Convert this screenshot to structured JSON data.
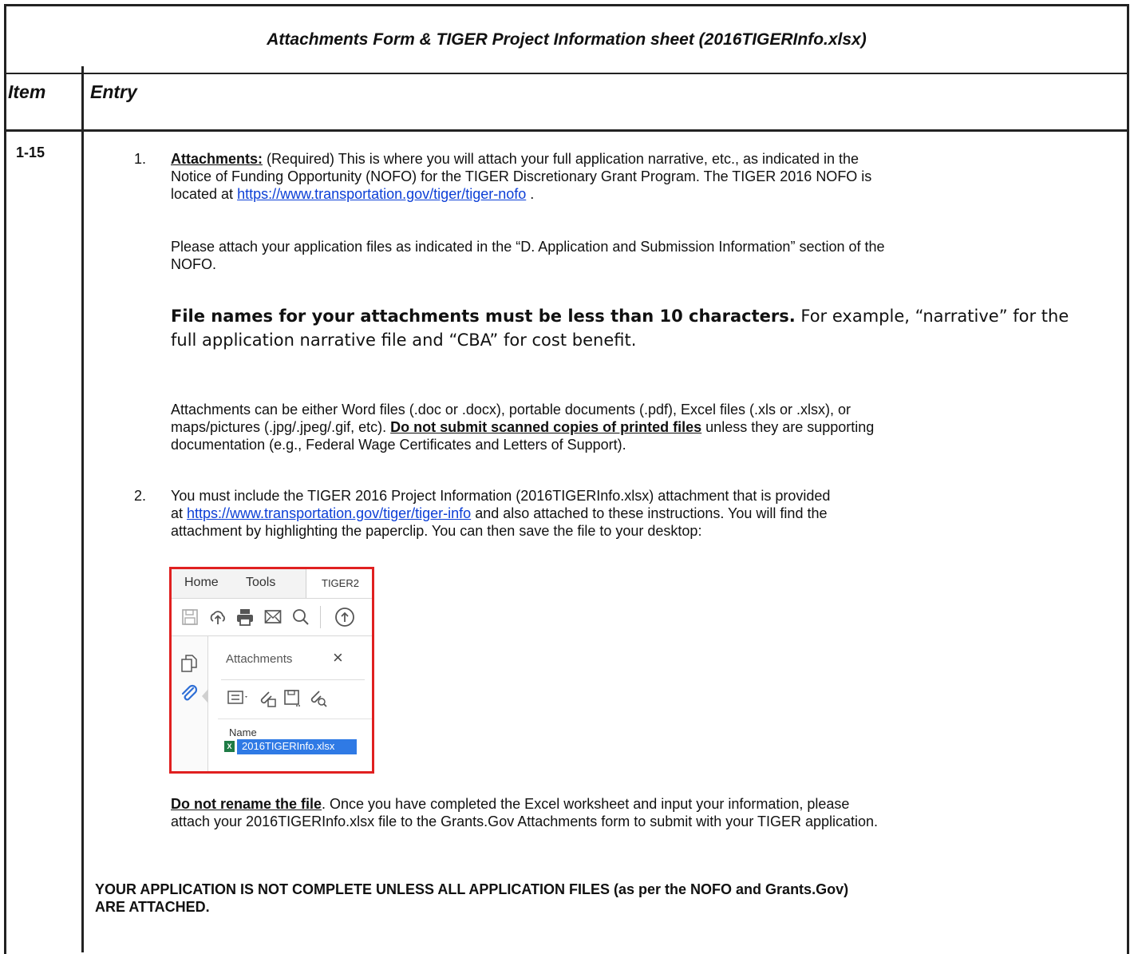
{
  "title": "Attachments Form & TIGER Project Information sheet (2016TIGERInfo.xlsx)",
  "header": {
    "item": "Item",
    "entry": "Entry"
  },
  "row": {
    "item": "1-15",
    "p1": {
      "num": "1.",
      "label": "Attachments:",
      "text_a": " (Required) This is where you will attach your full application narrative, etc., as indicated in the",
      "text_b": "Notice of Funding Opportunity (NOFO) for the TIGER Discretionary Grant Program. The TIGER 2016 NOFO is",
      "text_c": "located at ",
      "link": "https://www.transportation.gov/tiger/tiger-nofo",
      "text_d": " ."
    },
    "p2": {
      "line1": "Please attach your application files as indicated in the “D. Application and Submission Information” section of the",
      "line2": "NOFO."
    },
    "p3": {
      "bold": "File names for your attachments must be less than 10 characters.",
      "rest1": " For example, “narrative” for the",
      "rest2": "full application narrative file and “CBA” for cost benefit."
    },
    "p4": {
      "line1": "Attachments can be either Word files (.doc or .docx), portable documents (.pdf), Excel files (.xls or .xlsx), or",
      "line2a": "maps/pictures (.jpg/.jpeg/.gif, etc). ",
      "bold": "Do not submit scanned copies of printed files",
      "line2b": " unless they are supporting",
      "line3": "documentation (e.g., Federal Wage Certificates and Letters of Support)."
    },
    "p5": {
      "num": "2.",
      "line1": "You must include the TIGER 2016 Project Information (2016TIGERInfo.xlsx) attachment that is provided",
      "line2a": "at ",
      "link": "https://www.transportation.gov/tiger/tiger-info",
      "line2b": "  and also attached to these instructions. You will find the",
      "line3": "attachment by highlighting the paperclip. You can then save the file to your desktop:"
    },
    "p6": {
      "bold": "Do not rename the file",
      "line1": ". Once you have completed the Excel worksheet and input your information, please",
      "line2": "attach your 2016TIGERInfo.xlsx file to the Grants.Gov Attachments form to submit with your TIGER application."
    },
    "p7": {
      "line1": "YOUR APPLICATION IS NOT COMPLETE UNLESS ALL APPLICATION FILES (as per the NOFO and Grants.Gov)",
      "line2": "ARE ATTACHED."
    }
  },
  "screenshot": {
    "tab_home": "Home",
    "tab_tools": "Tools",
    "tab_doc": "TIGER2",
    "pane_title": "Attachments",
    "close": "×",
    "name_header": "Name",
    "file": "2016TIGERInfo.xlsx"
  }
}
